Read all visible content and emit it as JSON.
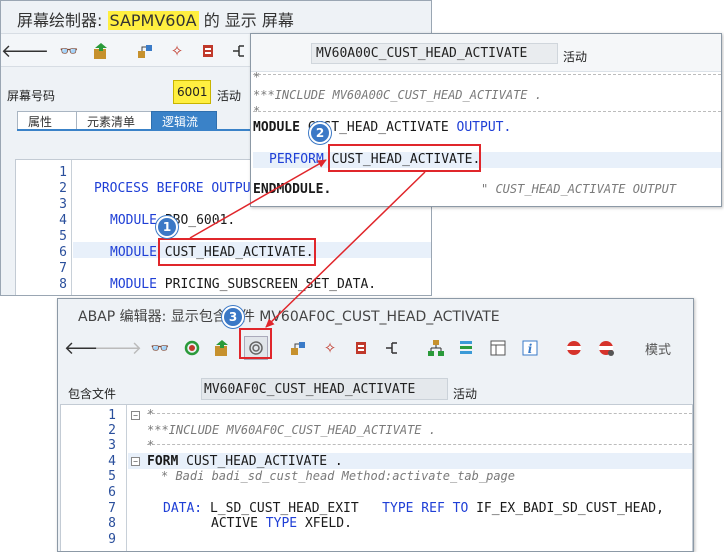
{
  "win1": {
    "title_prefix": "屏幕绘制器:",
    "title_program": "SAPMV60A",
    "title_suffix": "的 显示 屏幕",
    "screen_label": "屏幕号码",
    "screen_number": "6001",
    "status": "活动",
    "tabs": [
      "属性",
      "元素清单",
      "逻辑流"
    ],
    "lines": [
      "1",
      "2",
      "3",
      "4",
      "5",
      "6",
      "7",
      "8"
    ],
    "code": {
      "l2_kw": "PROCESS BEFORE OUTPUT",
      "l4_kw": "MODULE",
      "l4_name": "PBO_6001.",
      "l6_kw": "MODULE",
      "l6_name": "CUST_HEAD_ACTIVATE",
      "l6_end": ".",
      "l8_kw": "MODULE",
      "l8_name": "PRICING_SUBSCREEN_SET_DATA."
    }
  },
  "win2": {
    "include_name": "MV60A00C_CUST_HEAD_ACTIVATE",
    "status": "活动",
    "code": {
      "c1": "*---------------------------------------------------------------------",
      "c2": "***INCLUDE MV60A00C_CUST_HEAD_ACTIVATE .",
      "c3": "*---------------------------------------------------------------------",
      "l1_kw": "MODULE",
      "l1_name": "CUST_HEAD_ACTIVATE",
      "l1_kw2": "OUTPUT.",
      "l2_kw": "PERFORM",
      "l2_name": "CUST_HEAD_ACTIVATE",
      "l2_end": ".",
      "l3_kw": "ENDMODULE.",
      "l3_cmt": "\" CUST_HEAD_ACTIVATE  OUTPUT"
    }
  },
  "win3": {
    "title": "ABAP 编辑器: 显示包含文件 MV60AF0C_CUST_HEAD_ACTIVATE",
    "mode_label": "模式",
    "include_label": "包含文件",
    "include_name": "MV60AF0C_CUST_HEAD_ACTIVATE",
    "status": "活动",
    "lines": [
      "1",
      "2",
      "3",
      "4",
      "5",
      "6",
      "7",
      "8",
      "9"
    ],
    "code": {
      "c1": "*---------------------------------------------------------------------",
      "c2": "***INCLUDE MV60AF0C_CUST_HEAD_ACTIVATE .",
      "c3": "*---------------------------------------------------------------------",
      "l4_kw": "FORM",
      "l4_name": "CUST_HEAD_ACTIVATE .",
      "l5_cmt": "* Badi badi_sd_cust_head Method:activate_tab_page",
      "l7_kw": "DATA:",
      "l7_name": "L_SD_CUST_HEAD_EXIT",
      "l7_kw2": "TYPE REF TO",
      "l7_type": "IF_EX_BADI_SD_CUST_HEAD,",
      "l8_name": "ACTIVE",
      "l8_kw": "TYPE",
      "l8_type": "XFELD."
    }
  },
  "callouts": [
    "1",
    "2",
    "3"
  ],
  "colors": {
    "highlight": "#ffef40",
    "accent": "#3a82c8",
    "callout_red": "#e0262b",
    "badge_blue": "#3b78c6",
    "keyword": "#1f3fd6"
  }
}
